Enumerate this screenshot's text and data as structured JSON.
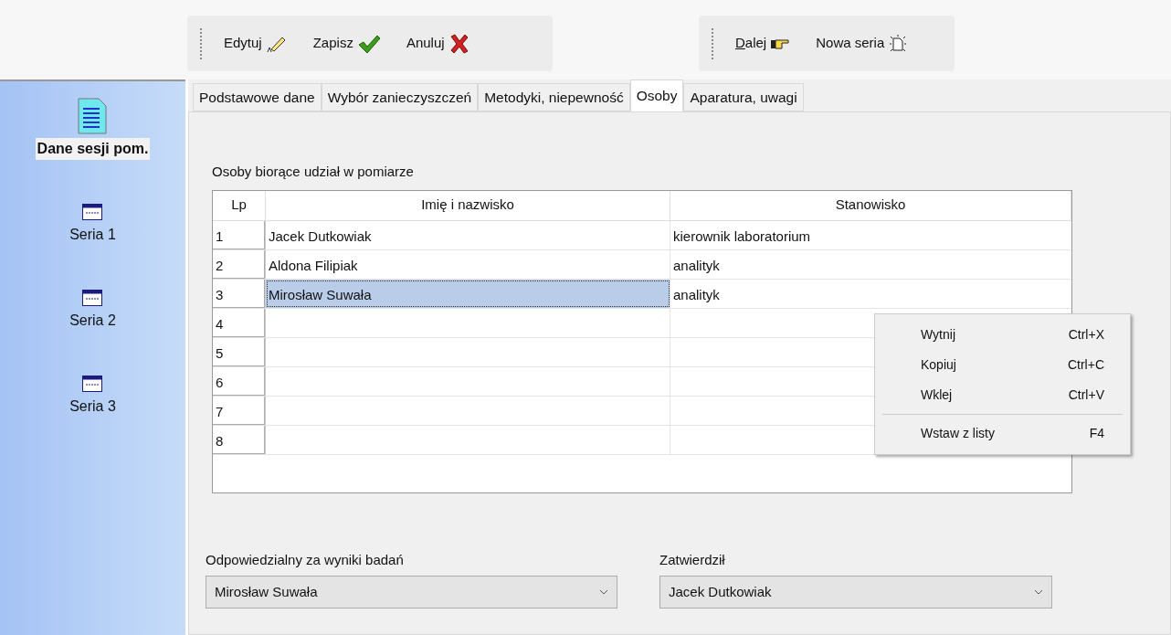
{
  "toolbar": {
    "groups": [
      {
        "buttons": [
          {
            "label": "Edytuj",
            "kind": "pencil",
            "mnemonic": false
          },
          {
            "label": "Zapisz",
            "kind": "check",
            "mnemonic": false
          },
          {
            "label": "Anuluj",
            "kind": "cross",
            "mnemonic": false
          }
        ]
      },
      {
        "buttons": [
          {
            "label": "Dalej",
            "kind": "hand",
            "mnemonic": true
          },
          {
            "label": "Nowa seria",
            "kind": "newdoc",
            "mnemonic": false
          }
        ]
      }
    ]
  },
  "sidebar": {
    "items": [
      {
        "label": "Dane sesji pom.",
        "kind": "document",
        "selected": true
      },
      {
        "label": "Seria 1",
        "kind": "window",
        "selected": false
      },
      {
        "label": "Seria 2",
        "kind": "window",
        "selected": false
      },
      {
        "label": "Seria 3",
        "kind": "window",
        "selected": false
      }
    ]
  },
  "tabs": [
    {
      "label": "Podstawowe dane",
      "selected": false
    },
    {
      "label": "Wybór zanieczyszczeń",
      "selected": false
    },
    {
      "label": "Metodyki, niepewność",
      "selected": false
    },
    {
      "label": "Osoby",
      "selected": true
    },
    {
      "label": "Aparatura, uwagi",
      "selected": false
    }
  ],
  "section_label": "Osoby biorące udział w pomiarze",
  "table": {
    "columns": [
      "Lp",
      "Imię i nazwisko",
      "Stanowisko"
    ],
    "rows": [
      {
        "cells": [
          "1",
          "Jacek Dutkowiak",
          "kierownik laboratorium"
        ],
        "selected_cell": false
      },
      {
        "cells": [
          "2",
          "Aldona Filipiak",
          "analityk"
        ],
        "selected_cell": false
      },
      {
        "cells": [
          "3",
          "Mirosław Suwała",
          "analityk"
        ],
        "selected_cell": true
      },
      {
        "cells": [
          "4"
        ],
        "selected_cell": false
      },
      {
        "cells": [
          "5"
        ],
        "selected_cell": false
      },
      {
        "cells": [
          "6"
        ],
        "selected_cell": false
      },
      {
        "cells": [
          "7"
        ],
        "selected_cell": false
      },
      {
        "cells": [
          "8"
        ],
        "selected_cell": false
      }
    ]
  },
  "context_menu": {
    "items": [
      {
        "kind": "item",
        "label": "Wytnij",
        "shortcut": "Ctrl+X"
      },
      {
        "kind": "item",
        "label": "Kopiuj",
        "shortcut": "Ctrl+C"
      },
      {
        "kind": "item",
        "label": "Wklej",
        "shortcut": "Ctrl+V"
      },
      {
        "kind": "separator"
      },
      {
        "kind": "item",
        "label": "Wstaw z listy",
        "shortcut": "F4"
      }
    ]
  },
  "fields": [
    {
      "label": "Odpowiedzialny za wyniki badań",
      "value": "Mirosław Suwała"
    },
    {
      "label": "Zatwierdził",
      "value": "Jacek Dutkowiak"
    }
  ]
}
